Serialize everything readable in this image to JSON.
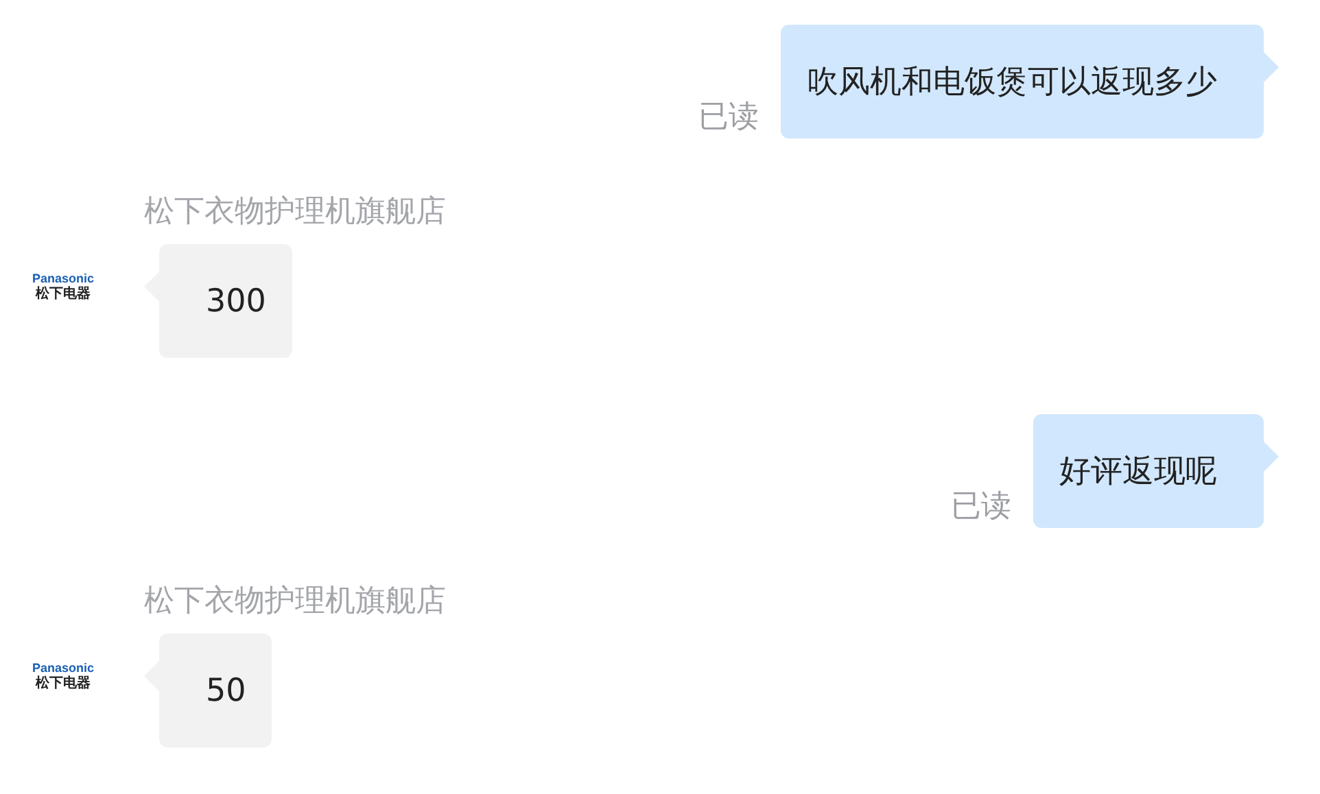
{
  "messages": [
    {
      "kind": "outgoing",
      "text": "吹风机和电饭煲可以返现多少",
      "receipt": "已读"
    },
    {
      "kind": "incoming",
      "sender": "松下衣物护理机旗舰店",
      "avatar": {
        "brand": "Panasonic",
        "subtitle": "松下电器"
      },
      "text": "300"
    },
    {
      "kind": "outgoing",
      "text": "好评返现呢",
      "receipt": "已读"
    },
    {
      "kind": "incoming",
      "sender": "松下衣物护理机旗舰店",
      "avatar": {
        "brand": "Panasonic",
        "subtitle": "松下电器"
      },
      "text": "50"
    }
  ]
}
